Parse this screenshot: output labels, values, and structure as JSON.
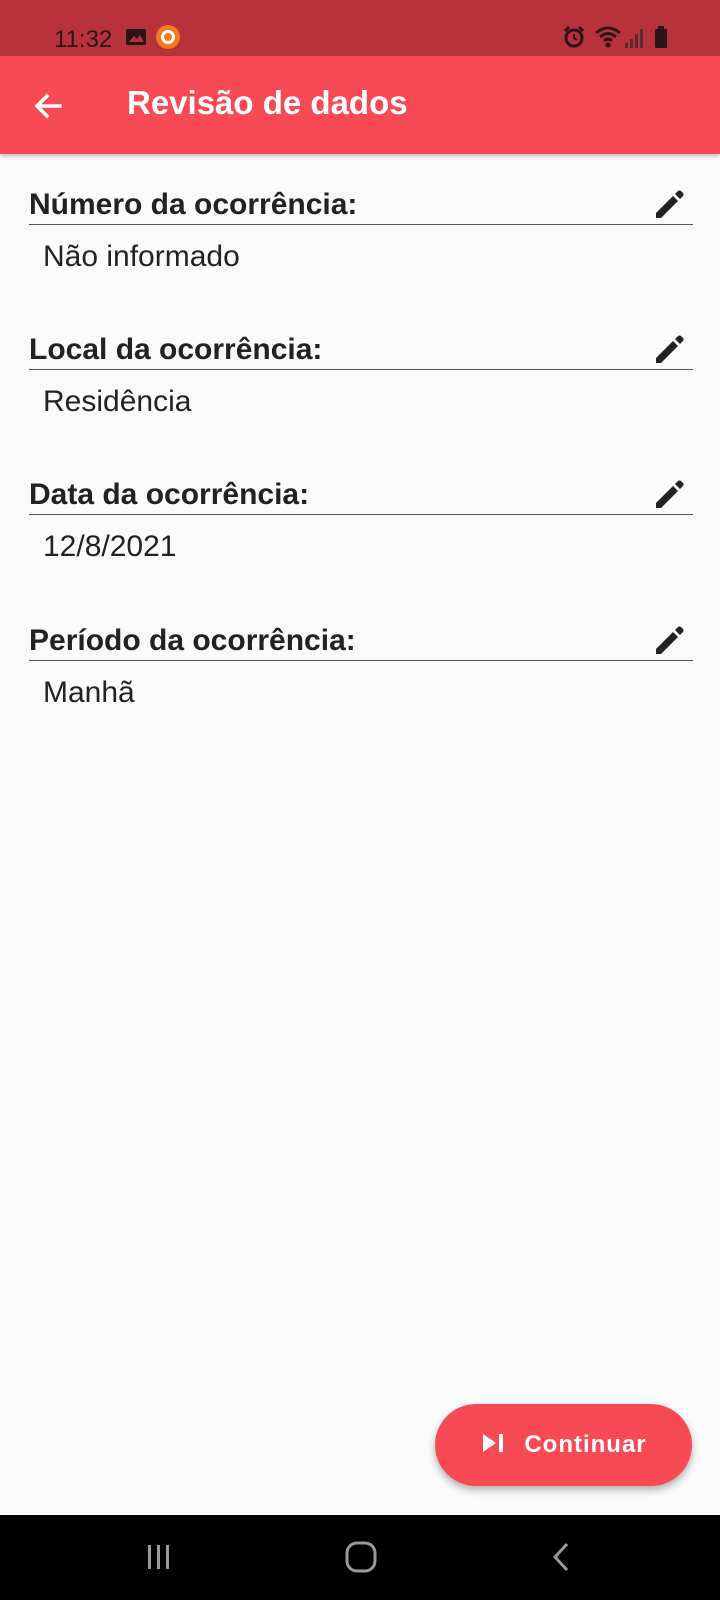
{
  "status_bar": {
    "time": "11:32",
    "icons": [
      "gallery-icon",
      "recorder-icon",
      "alarm-icon",
      "wifi-icon",
      "signal-icon",
      "battery-icon"
    ]
  },
  "app_bar": {
    "title": "Revisão de dados",
    "back_icon": "arrow-back-icon"
  },
  "fields": [
    {
      "label": "Número da ocorrência:",
      "value": "Não informado"
    },
    {
      "label": "Local da ocorrência:",
      "value": "Residência"
    },
    {
      "label": "Data da ocorrência:",
      "value": "12/8/2021"
    },
    {
      "label": "Período da ocorrência:",
      "value": "Manhã"
    }
  ],
  "fab": {
    "label": "Continuar",
    "icon": "skip-next-icon"
  },
  "navigation_bar": {
    "buttons": [
      "recents-icon",
      "home-icon",
      "back-icon"
    ]
  },
  "colors": {
    "status_bar": "#b8323c",
    "app_bar": "#f84a55",
    "accent": "#f84a55",
    "background": "#fafafa",
    "text": "#222222"
  }
}
